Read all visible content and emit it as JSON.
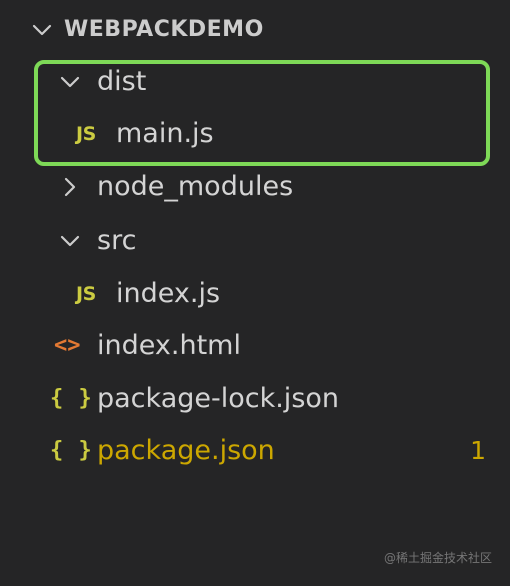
{
  "explorer": {
    "root": {
      "label": "WEBPACKDEMO",
      "icon": "chevron-down-icon"
    },
    "items": [
      {
        "label": "dist",
        "type": "folder",
        "expanded": true,
        "icon": "chevron-down-icon"
      },
      {
        "label": "main.js",
        "type": "file",
        "icon_text": "JS",
        "icon": "js-file-icon"
      },
      {
        "label": "node_modules",
        "type": "folder",
        "expanded": false,
        "icon": "chevron-right-icon"
      },
      {
        "label": "src",
        "type": "folder",
        "expanded": true,
        "icon": "chevron-down-icon"
      },
      {
        "label": "index.js",
        "type": "file",
        "icon_text": "JS",
        "icon": "js-file-icon"
      },
      {
        "label": "index.html",
        "type": "file",
        "icon_text": "<>",
        "icon": "html-file-icon"
      },
      {
        "label": "package-lock.json",
        "type": "file",
        "icon_text": "{ }",
        "icon": "json-file-icon"
      },
      {
        "label": "package.json",
        "type": "file",
        "icon_text": "{ }",
        "icon": "json-file-icon",
        "badge": "1",
        "modified": true
      }
    ]
  },
  "colors": {
    "background": "#252526",
    "text": "#d4d4d4",
    "modified_text": "#cca700",
    "js_icon": "#cbcb41",
    "json_icon": "#cbcb41",
    "html_icon": "#e37933",
    "highlight_border": "#7ed957"
  },
  "watermark": "@稀土掘金技术社区"
}
